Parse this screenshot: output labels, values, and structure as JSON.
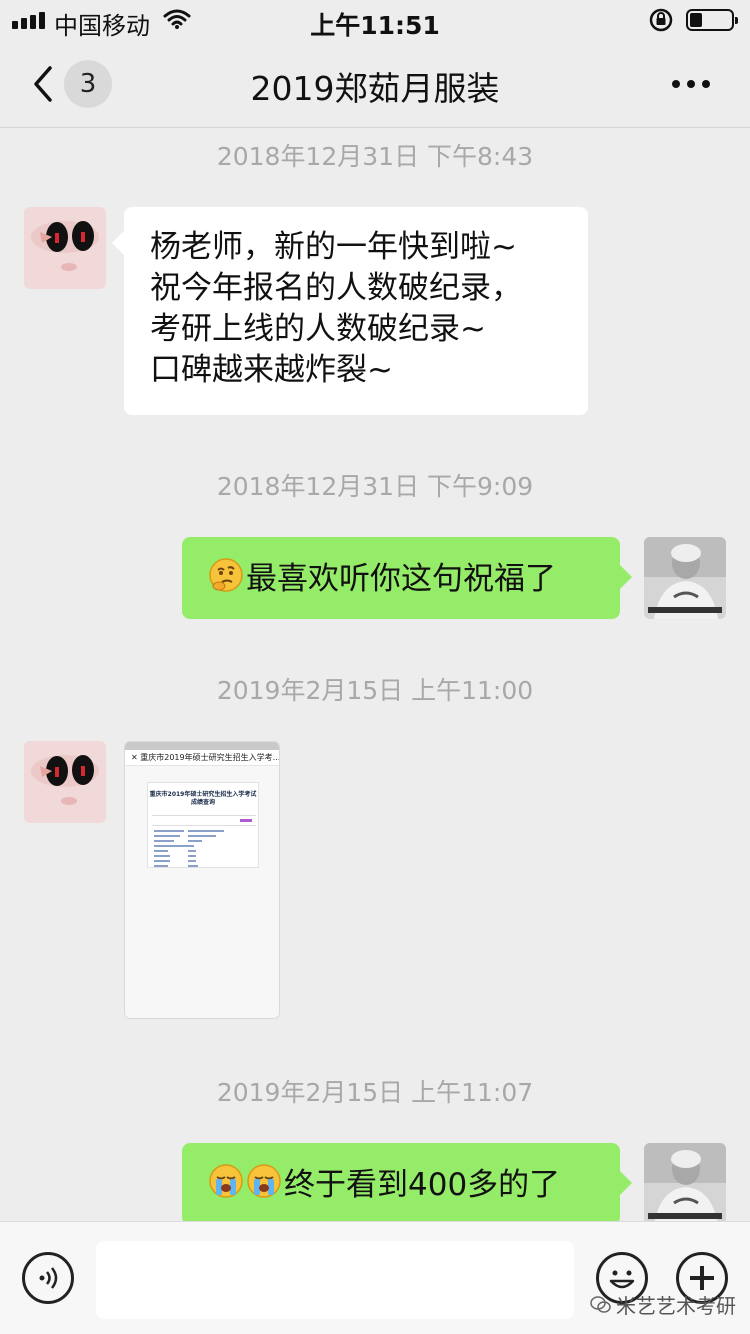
{
  "status_bar": {
    "carrier": "中国移动",
    "time": "上午11:51",
    "battery_level": 0.3
  },
  "nav": {
    "back_label": "3",
    "title": "2019郑茹月服装"
  },
  "messages": [
    {
      "type": "timestamp",
      "text": "2018年12月31日 下午8:43"
    },
    {
      "type": "text",
      "side": "left",
      "lines": [
        "杨老师，新的一年快到啦~",
        "祝今年报名的人数破纪录，",
        "考研上线的人数破纪录~",
        "口碑越来越炸裂~"
      ]
    },
    {
      "type": "timestamp",
      "text": "2018年12月31日 下午9:09"
    },
    {
      "type": "text",
      "side": "right",
      "emoji": "thinking-face",
      "text": "最喜欢听你这句祝福了"
    },
    {
      "type": "timestamp",
      "text": "2019年2月15日 上午11:00"
    },
    {
      "type": "image",
      "side": "left",
      "preview_header": "重庆市2019年硕士研究生招生入学考...",
      "preview_title": "重庆市2019年硕士研究生招生入学考试成绩查询"
    },
    {
      "type": "timestamp",
      "text": "2019年2月15日 上午11:07"
    },
    {
      "type": "text",
      "side": "right",
      "emoji": "loudly-crying-face",
      "text": "终于看到400多的了"
    }
  ],
  "input_bar": {
    "placeholder": ""
  },
  "watermark": "米艺艺术考研",
  "colors": {
    "background": "#ededed",
    "sent_bubble": "#95ec69",
    "received_bubble": "#ffffff",
    "timestamp_text": "#a8a8a8"
  }
}
